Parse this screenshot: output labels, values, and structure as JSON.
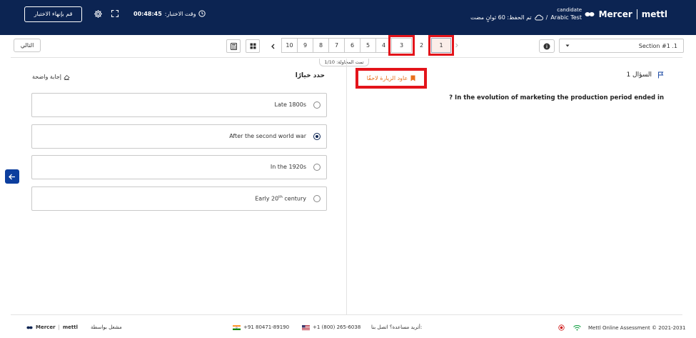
{
  "header": {
    "exit_label": "قم بإنهاء الاختبار",
    "timer_label": "وقت الاختبار:",
    "timer_value": "00:48:45",
    "candidate_label": "candidate",
    "test_name": "Arabic Test",
    "separator": "/",
    "saved_status": "تم الحفظ: 60 ثوانٍ مضت",
    "logo_mercer": "Mercer",
    "logo_mettl": "mettl"
  },
  "toolbar": {
    "next_label": "التالي",
    "pages": [
      "10",
      "9",
      "8",
      "7",
      "6",
      "5",
      "4",
      "3",
      "2",
      "1"
    ],
    "current_page": "1",
    "attempt_label": "تمت المحاولة: 1/10",
    "section_label": "Section #1 .1"
  },
  "question": {
    "review_label": "عاود الزيارة لاحقًا",
    "number_label": "السؤال 1",
    "text": "? In the evolution of marketing the production period ended in"
  },
  "answers": {
    "choose_label": "حدد خيارًا",
    "clear_label": "إجابة واضحة",
    "options": [
      {
        "text": "Late 1800s",
        "selected": false
      },
      {
        "text": "After the second world war",
        "selected": true
      },
      {
        "text": "In the 1920s",
        "selected": false
      },
      {
        "text_main": "Early 20",
        "text_sup": "th",
        "text_tail": " century",
        "selected": false
      }
    ]
  },
  "footer": {
    "powered_by": "مشغل بواسطة",
    "footer_mercer": "Mercer",
    "footer_mettl": "mettl",
    "india_phone": "+91 80471-89190",
    "us_phone": "+1 (800) 265-6038",
    "help_label": "أتريد مساعدة؟ اتصل بنا:",
    "copyright": "Mettl Online Assessment © 2021-2031"
  },
  "colors": {
    "header_bg": "#0c2452",
    "highlight_red": "#e3141b",
    "review_orange": "#e8701c",
    "collapse_blue": "#0c3e9e"
  }
}
